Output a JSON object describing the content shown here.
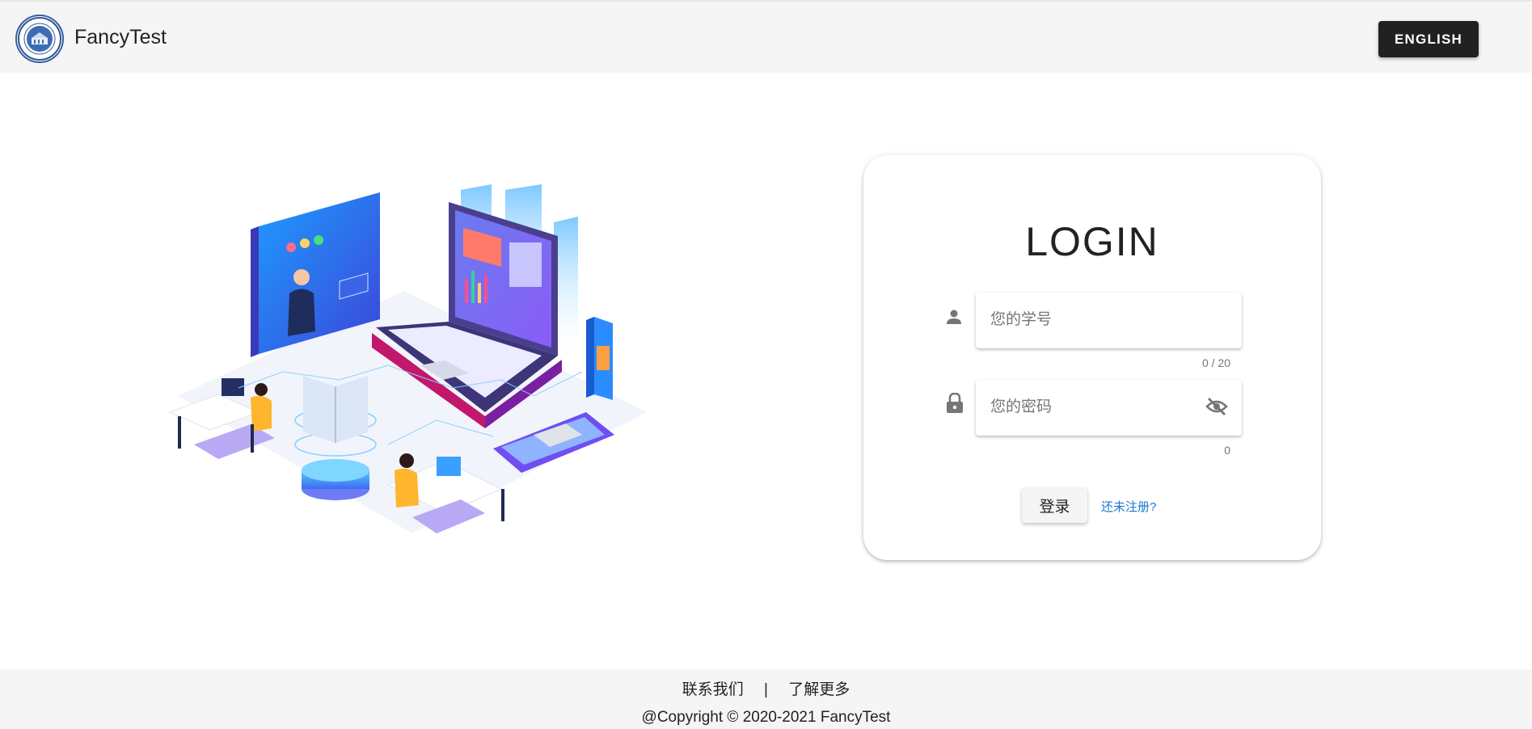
{
  "header": {
    "brand": "FancyTest",
    "language_button": "ENGLISH"
  },
  "login": {
    "title": "LOGIN",
    "username": {
      "placeholder": "您的学号",
      "value": "",
      "counter": "0 / 20",
      "icon": "person-icon"
    },
    "password": {
      "placeholder": "您的密码",
      "value": "",
      "counter": "0",
      "icon": "lock-icon",
      "toggle_icon": "eye-off-icon"
    },
    "submit_label": "登录",
    "register_link": "还未注册?"
  },
  "footer": {
    "links": [
      "联系我们",
      "了解更多"
    ],
    "separator": "|",
    "copyright": "@Copyright © 2020-2021 FancyTest"
  },
  "colors": {
    "accent_link": "#1976d2",
    "dark_button": "#212121",
    "bar_background": "#f5f5f5"
  }
}
